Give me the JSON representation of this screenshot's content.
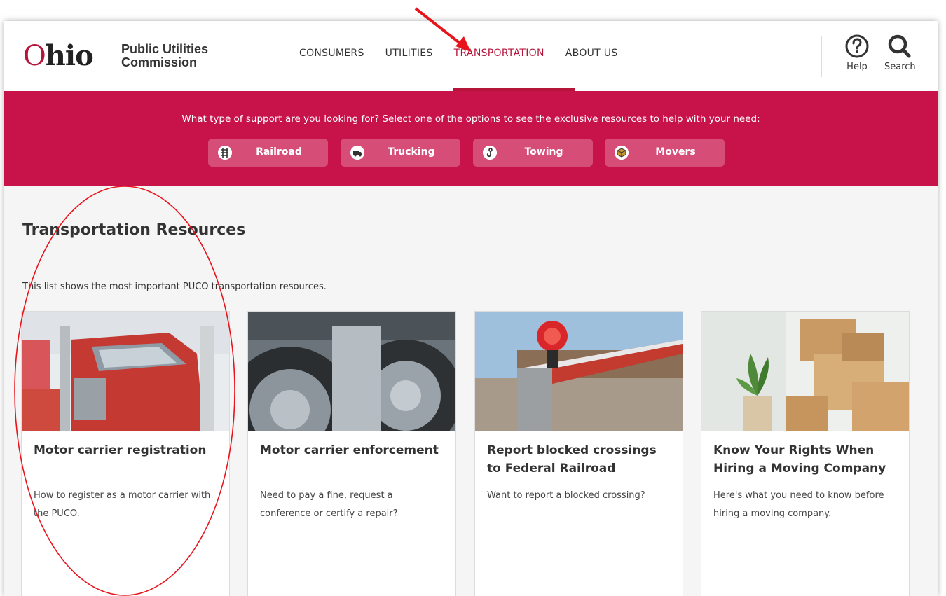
{
  "header": {
    "logo_word_o": "O",
    "logo_word_rest": "hio",
    "logo_line1": "Public Utilities",
    "logo_line2": "Commission",
    "nav": [
      {
        "label": "CONSUMERS",
        "active": false
      },
      {
        "label": "UTILITIES",
        "active": false
      },
      {
        "label": "TRANSPORTATION",
        "active": true
      },
      {
        "label": "ABOUT US",
        "active": false
      }
    ],
    "help_label": "Help",
    "search_label": "Search"
  },
  "banner": {
    "prompt": "What type of support are you looking for? Select one of the options to see the exclusive resources to help with your need:",
    "options": [
      {
        "label": "Railroad",
        "icon": "railroad-icon"
      },
      {
        "label": "Trucking",
        "icon": "truck-icon"
      },
      {
        "label": "Towing",
        "icon": "tow-hook-icon"
      },
      {
        "label": "Movers",
        "icon": "box-icon"
      }
    ]
  },
  "main": {
    "title": "Transportation Resources",
    "intro": "This list shows the most important PUCO transportation resources.",
    "cards": [
      {
        "title": "Motor carrier registration",
        "desc": "How to register as a motor carrier with the PUCO.",
        "image": "red-semi-truck"
      },
      {
        "title": "Motor carrier enforcement",
        "desc": "Need to pay a fine, request a conference or certify a repair?",
        "image": "truck-wheels"
      },
      {
        "title": "Report blocked crossings to Federal Railroad",
        "desc": "Want to report a blocked crossing?",
        "image": "railroad-crossing-gate"
      },
      {
        "title": "Know Your Rights When Hiring a Moving Company",
        "desc": "Here's what you need to know before hiring a moving company.",
        "image": "moving-boxes"
      }
    ]
  },
  "colors": {
    "brand": "#c8124a",
    "annotation": "#e8141c"
  }
}
